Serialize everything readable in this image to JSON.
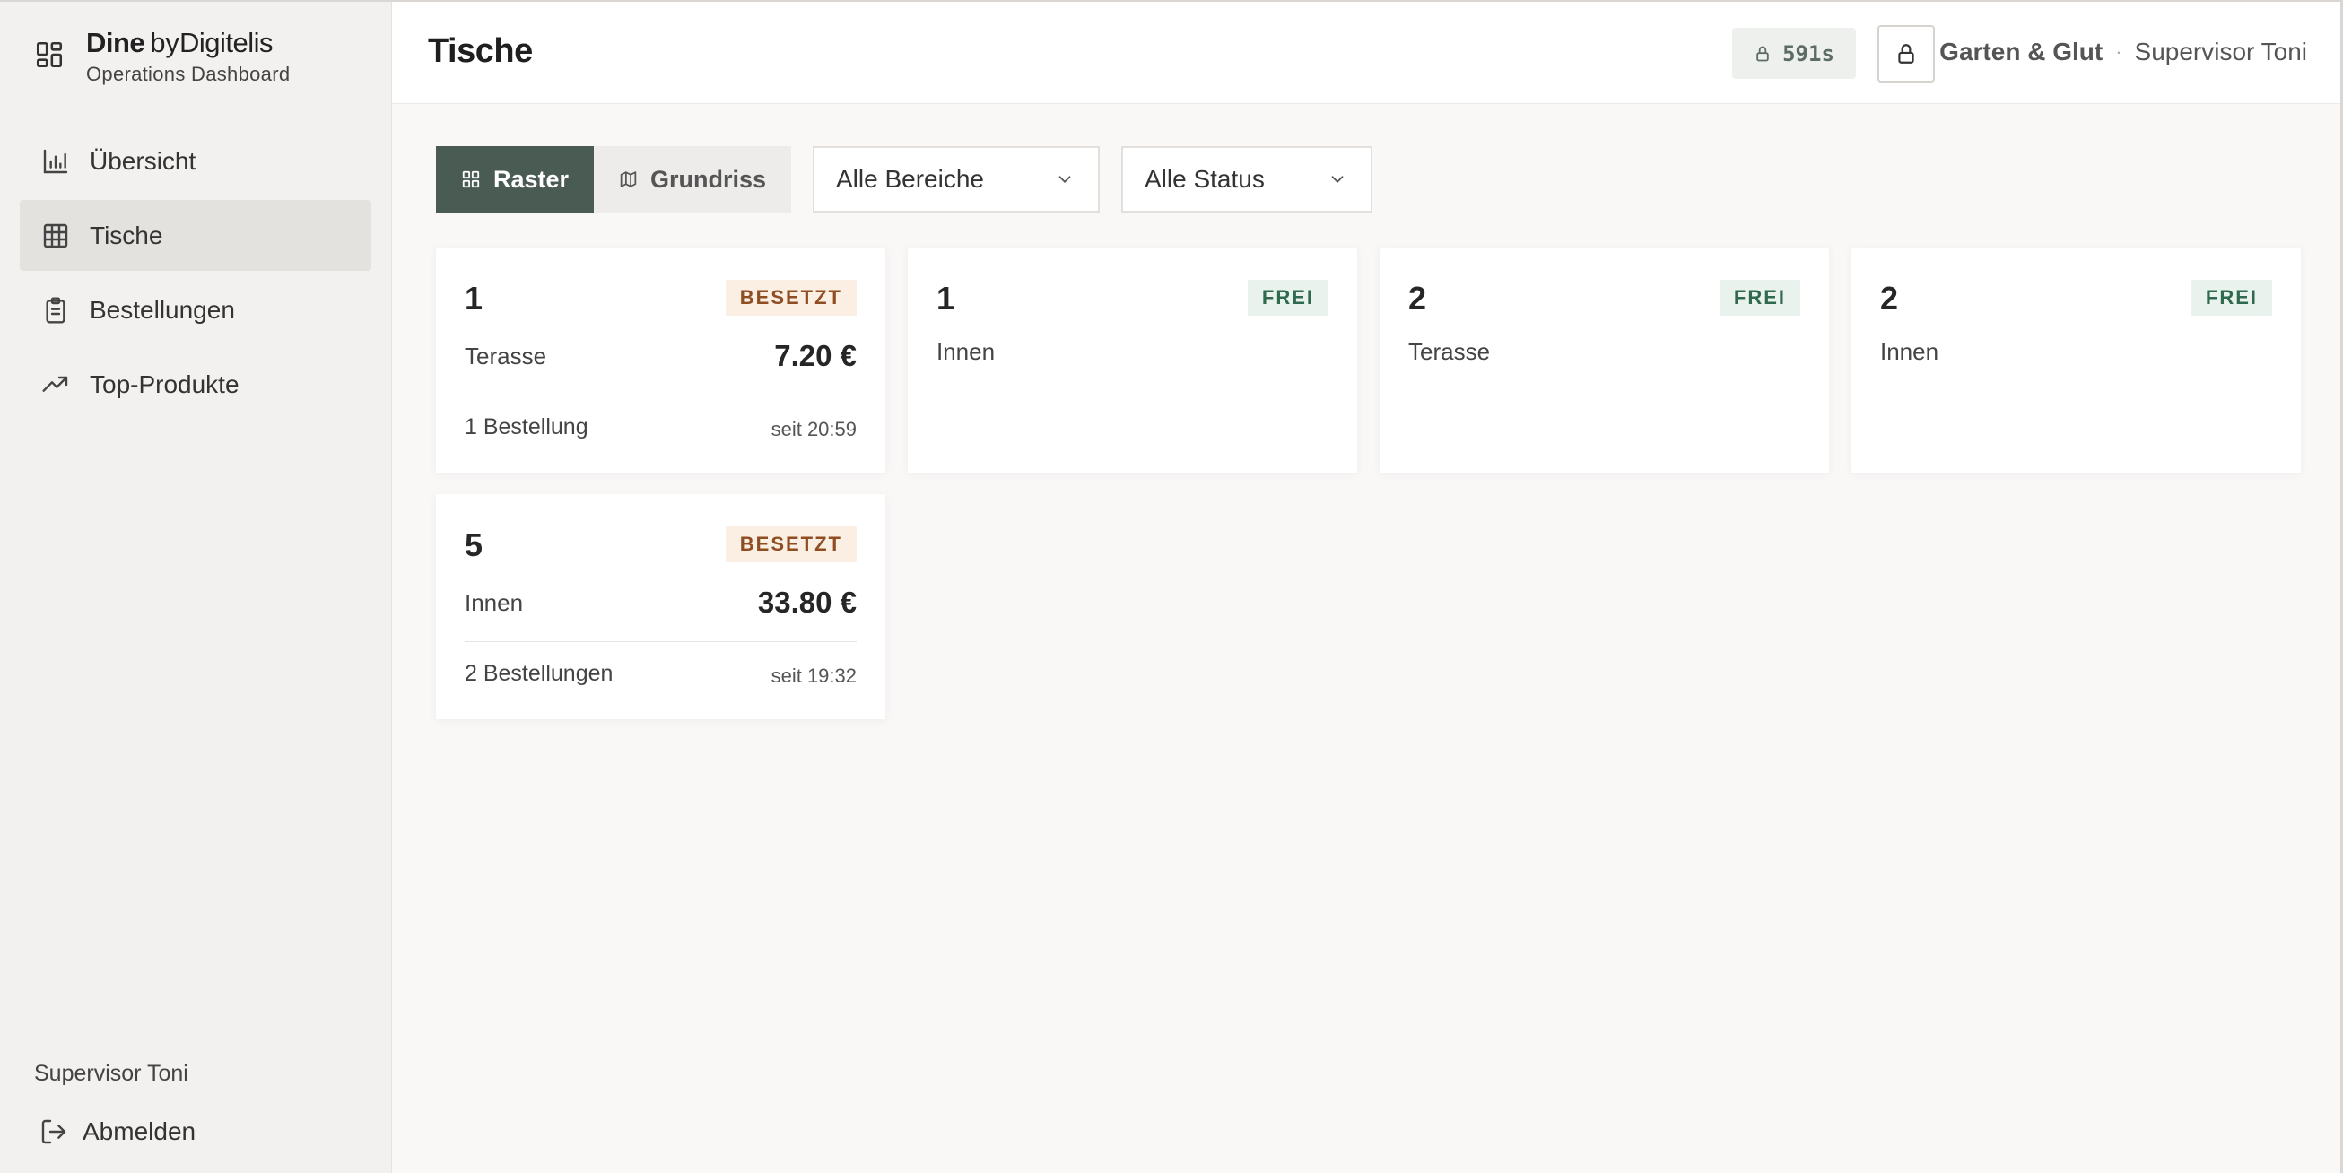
{
  "brand": {
    "name": "Dine",
    "by": "by",
    "company": "Digitelis",
    "subtitle": "Operations Dashboard"
  },
  "nav": {
    "items": [
      {
        "label": "Übersicht",
        "icon": "bar-chart-icon"
      },
      {
        "label": "Tische",
        "icon": "grid-table-icon",
        "active": true
      },
      {
        "label": "Bestellungen",
        "icon": "clipboard-icon"
      },
      {
        "label": "Top-Produkte",
        "icon": "trending-up-icon"
      }
    ]
  },
  "sidebar_footer": {
    "user": "Supervisor Toni",
    "logout_label": "Abmelden"
  },
  "header": {
    "title": "Tische",
    "timer": "591s",
    "restaurant": "Garten & Glut",
    "separator": "·",
    "user": "Supervisor Toni"
  },
  "toolbar": {
    "view_grid_label": "Raster",
    "view_floor_label": "Grundriss",
    "area_select": "Alle Bereiche",
    "status_select": "Alle Status"
  },
  "tables": [
    {
      "number": "1",
      "status": "BESETZT",
      "area": "Terasse",
      "total": "7.20 €",
      "orders": "1 Bestellung",
      "since": "seit 20:59"
    },
    {
      "number": "1",
      "status": "FREI",
      "area": "Innen"
    },
    {
      "number": "2",
      "status": "FREI",
      "area": "Terasse"
    },
    {
      "number": "2",
      "status": "FREI",
      "area": "Innen"
    },
    {
      "number": "5",
      "status": "BESETZT",
      "area": "Innen",
      "total": "33.80 €",
      "orders": "2 Bestellungen",
      "since": "seit 19:32"
    }
  ],
  "colors": {
    "accent": "#4a5b54",
    "busy_bg": "#fbeee3",
    "busy_text": "#8f4d22",
    "free_bg": "#e9f2ed",
    "free_text": "#2f6a4e"
  }
}
